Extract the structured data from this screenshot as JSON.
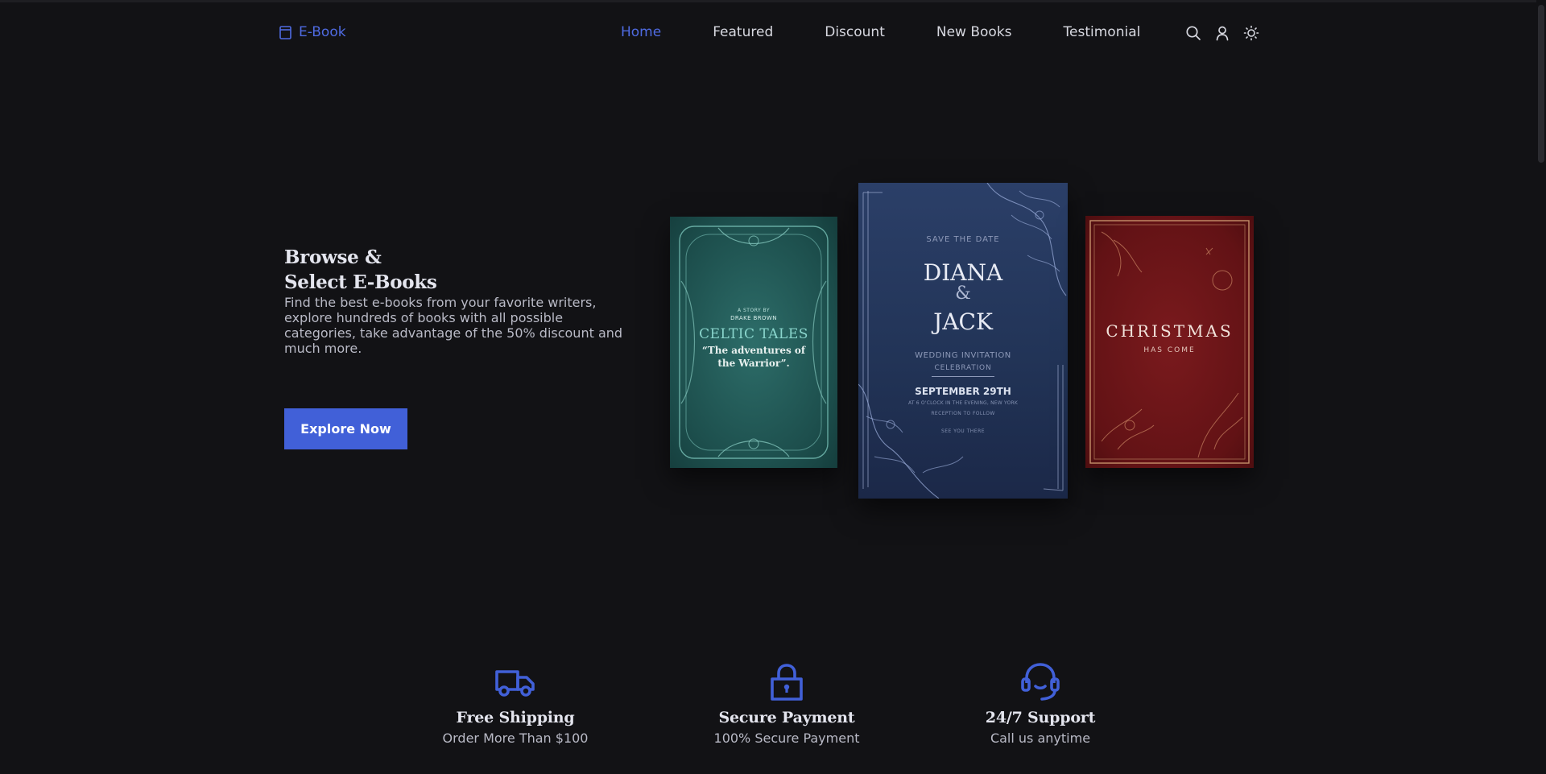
{
  "header": {
    "logo": {
      "icon": "book-icon",
      "text": "E-Book"
    },
    "nav": [
      {
        "label": "Home",
        "active": true
      },
      {
        "label": "Featured",
        "active": false
      },
      {
        "label": "Discount",
        "active": false
      },
      {
        "label": "New Books",
        "active": false
      },
      {
        "label": "Testimonial",
        "active": false
      }
    ],
    "icons": [
      "search-icon",
      "user-icon",
      "sun-icon"
    ]
  },
  "hero": {
    "title_line1": "Browse &",
    "title_line2": "Select E-Books",
    "description": "Find the best e-books from your favorite writers, explore hundreds of books with all possible categories, take advantage of the 50% discount and much more.",
    "button_label": "Explore Now"
  },
  "books": {
    "celtic": {
      "line1": "A STORY BY",
      "line2": "DRAKE BROWN",
      "title": "CELTIC TALES",
      "sub1": "“The adventures of",
      "sub2": "the Warrior”."
    },
    "wedding": {
      "save": "SAVE THE DATE",
      "name1": "DIANA",
      "amp": "&",
      "name2": "JACK",
      "invite": "WEDDING INVITATION",
      "celebration": "CELEBRATION",
      "date": "SEPTEMBER 29TH",
      "time": "AT 6 O'CLOCK IN THE EVENING, NEW YORK",
      "reception": "RECEPTION TO FOLLOW",
      "see": "SEE YOU THERE"
    },
    "christmas": {
      "title": "CHRISTMAS",
      "sub": "HAS COME"
    }
  },
  "features": [
    {
      "icon": "truck-icon",
      "title": "Free Shipping",
      "subtitle": "Order More Than $100"
    },
    {
      "icon": "lock-icon",
      "title": "Secure Payment",
      "subtitle": "100% Secure Payment"
    },
    {
      "icon": "headset-icon",
      "title": "24/7 Support",
      "subtitle": "Call us anytime"
    }
  ],
  "colors": {
    "background": "#121215",
    "accent": "#4160d8",
    "accent_text": "#4f6be2",
    "text": "#d7d8e0"
  }
}
